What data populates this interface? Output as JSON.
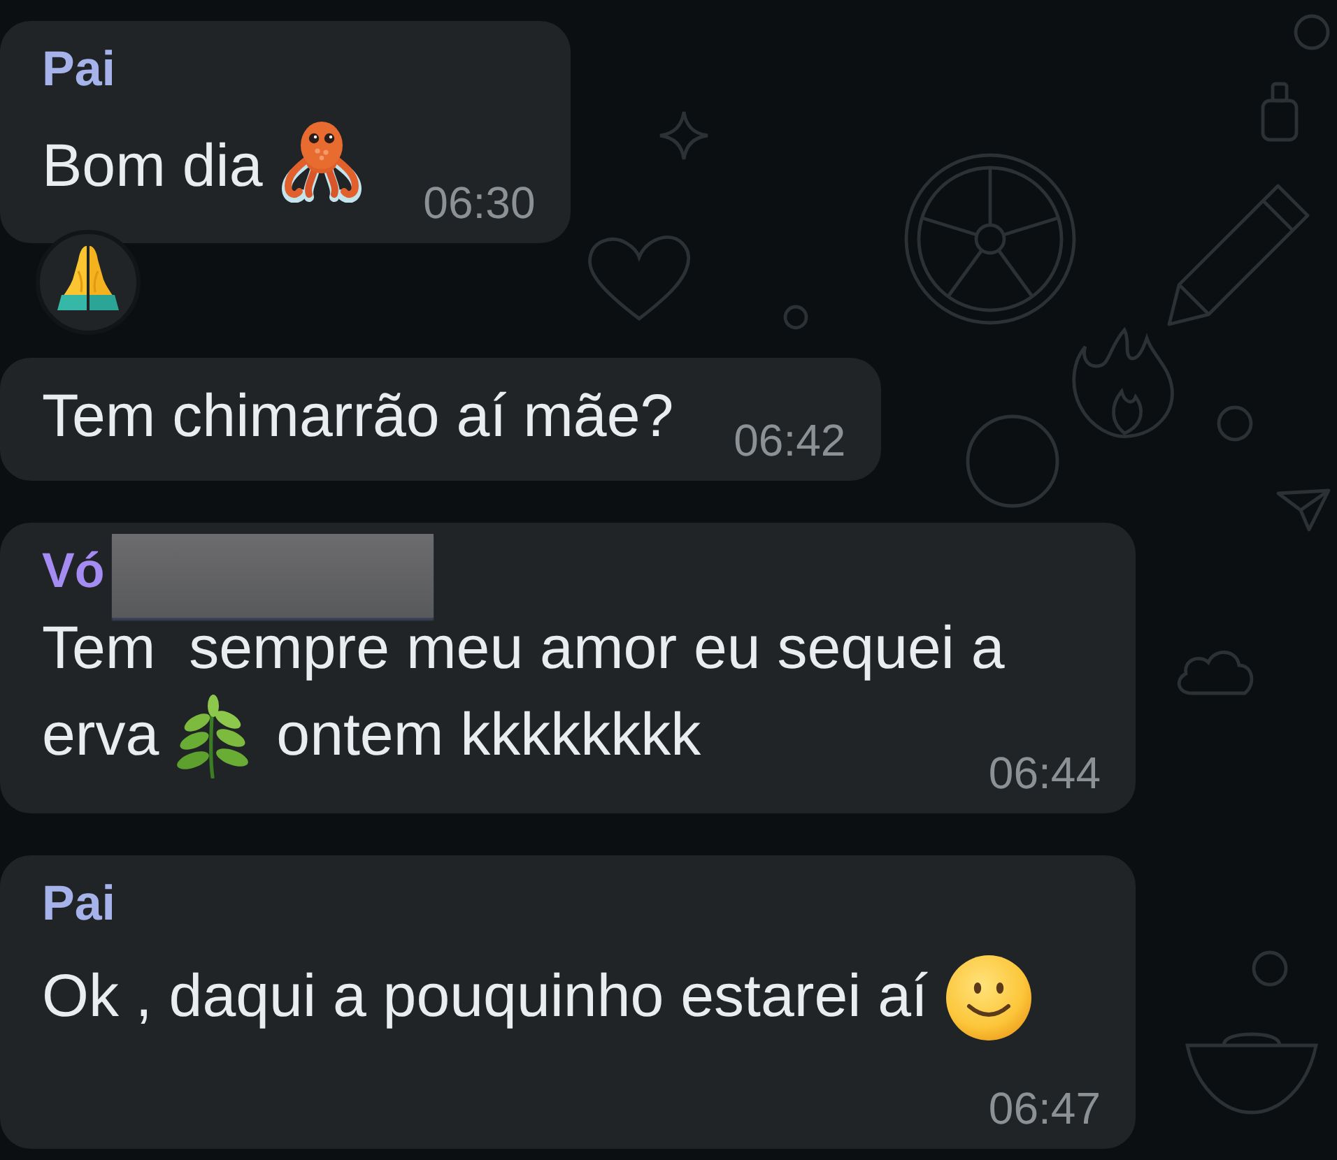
{
  "messages": [
    {
      "sender": {
        "name": "Pai",
        "color": "#a5b3ea",
        "redacted": false
      },
      "body": [
        {
          "kind": "text",
          "text": "Bom dia"
        },
        {
          "kind": "octopus"
        }
      ],
      "time": "06:30",
      "reactions": [
        {
          "kind": "pray"
        }
      ]
    },
    {
      "body": [
        {
          "kind": "text",
          "text": "Tem chimarrão aí mãe?"
        }
      ],
      "time": "06:42"
    },
    {
      "sender": {
        "name": "Vó",
        "color": "#a48cf2",
        "redacted": true
      },
      "body": [
        {
          "kind": "text",
          "text": "Tem  sempre meu amor eu sequei a"
        },
        {
          "kind": "text",
          "text": "erva"
        },
        {
          "kind": "herb"
        },
        {
          "kind": "text",
          "text": "ontem kkkkkkkk"
        }
      ],
      "time": "06:44"
    },
    {
      "sender": {
        "name": "Pai",
        "color": "#a5b3ea",
        "redacted": false
      },
      "body": [
        {
          "kind": "text",
          "text": "Ok , daqui a pouquinho estarei aí"
        },
        {
          "kind": "smiley"
        }
      ],
      "time": "06:47"
    }
  ]
}
